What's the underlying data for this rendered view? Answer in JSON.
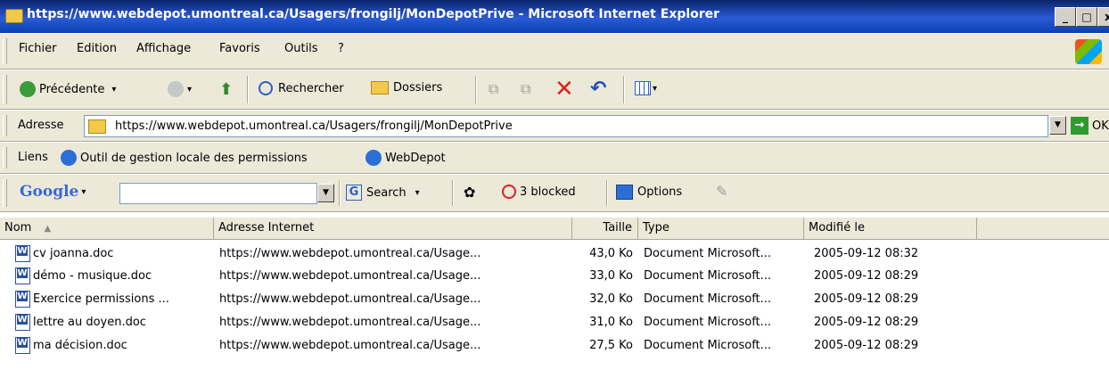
{
  "window": {
    "title": "https://www.webdepot.umontreal.ca/Usagers/frongilj/MonDepotPrive - Microsoft Internet Explorer",
    "minimize": "_",
    "maximize": "□",
    "close": "x"
  },
  "menu": [
    "Fichier",
    "Edition",
    "Affichage",
    "Favoris",
    "Outils",
    "?"
  ],
  "toolbar": {
    "back": "Précédente",
    "search": "Rechercher",
    "folders": "Dossiers"
  },
  "address": {
    "label": "Adresse",
    "value": "https://www.webdepot.umontreal.ca/Usagers/frongilj/MonDepotPrive",
    "go": "OK"
  },
  "links": {
    "label": "Liens",
    "items": [
      "Outil de gestion locale des permissions",
      "WebDepot"
    ]
  },
  "google": {
    "logo": "Google",
    "search_value": "",
    "search_btn": "Search",
    "blocked": "3 blocked",
    "options": "Options"
  },
  "columns": [
    "Nom",
    "Adresse Internet",
    "Taille",
    "Type",
    "Modifié le"
  ],
  "rows": [
    {
      "name": "cv joanna.doc",
      "url": "https://www.webdepot.umontreal.ca/Usage...",
      "size": "43,0 Ko",
      "type": "Document Microsoft...",
      "modified": "2005-09-12 08:32"
    },
    {
      "name": "démo - musique.doc",
      "url": "https://www.webdepot.umontreal.ca/Usage...",
      "size": "33,0 Ko",
      "type": "Document Microsoft...",
      "modified": "2005-09-12 08:29"
    },
    {
      "name": "Exercice permissions ...",
      "url": "https://www.webdepot.umontreal.ca/Usage...",
      "size": "32,0 Ko",
      "type": "Document Microsoft...",
      "modified": "2005-09-12 08:29"
    },
    {
      "name": "lettre au doyen.doc",
      "url": "https://www.webdepot.umontreal.ca/Usage...",
      "size": "31,0 Ko",
      "type": "Document Microsoft...",
      "modified": "2005-09-12 08:29"
    },
    {
      "name": "ma décision.doc",
      "url": "https://www.webdepot.umontreal.ca/Usage...",
      "size": "27,5 Ko",
      "type": "Document Microsoft...",
      "modified": "2005-09-12 08:29"
    }
  ]
}
